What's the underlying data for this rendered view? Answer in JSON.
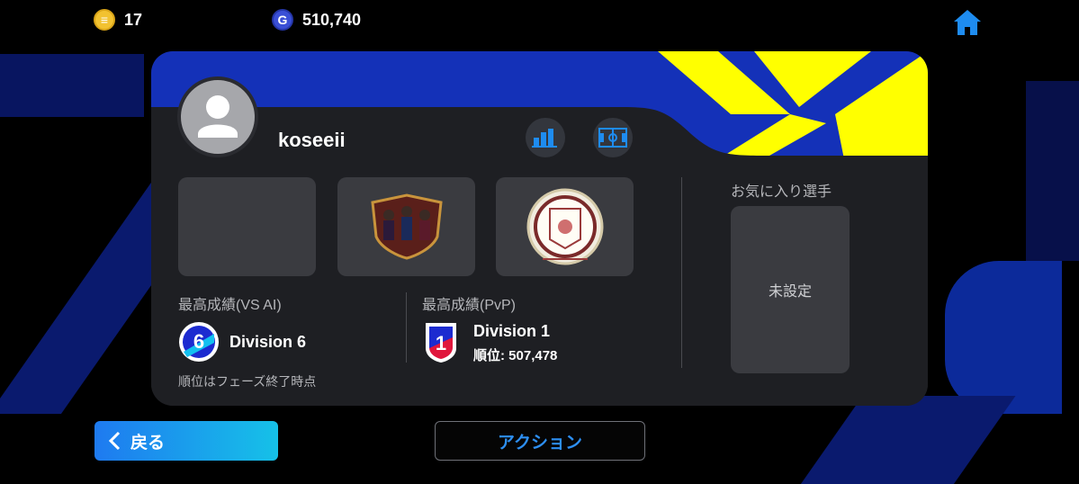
{
  "currency": {
    "coins": "17",
    "gp": "510,740",
    "coin_icon": "efootball-coin-icon",
    "gp_icon": "gp-icon"
  },
  "profile": {
    "username": "koseeii",
    "stats_button_icon": "bar-chart-icon",
    "formation_button_icon": "formation-icon"
  },
  "slots": [
    {
      "name": "empty-slot"
    },
    {
      "name": "team-emblem"
    },
    {
      "name": "club-badge"
    }
  ],
  "records": {
    "vs_ai": {
      "label": "最高成績(VS AI)",
      "division": "Division 6",
      "badge_number": "6",
      "note": "順位はフェーズ終了時点"
    },
    "pvp": {
      "label": "最高成績(PvP)",
      "division": "Division 1",
      "badge_number": "1",
      "rank": "順位: 507,478"
    }
  },
  "favorite": {
    "title": "お気に入り選手",
    "value": "未設定"
  },
  "buttons": {
    "back": "戻る",
    "action": "アクション"
  },
  "colors": {
    "accent_blue": "#1431b8",
    "accent_yellow": "#ffff00",
    "button_gradient_start": "#1e7af0",
    "button_gradient_end": "#16c1e8",
    "action_text": "#2d8ff2"
  }
}
